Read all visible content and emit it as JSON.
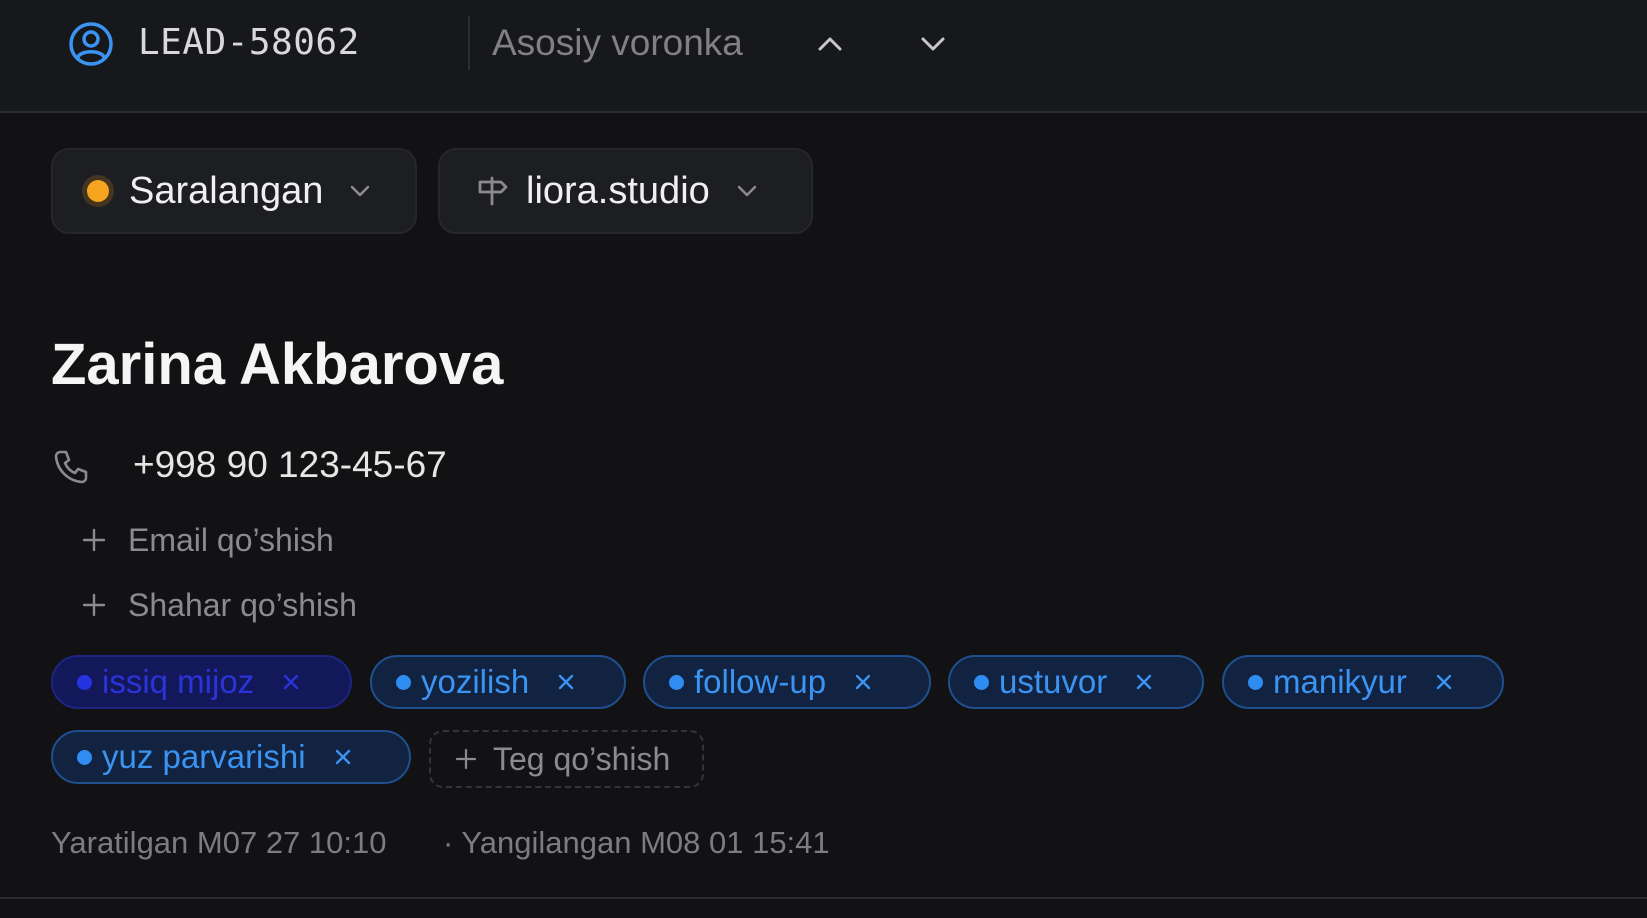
{
  "header": {
    "lead_id": "LEAD-58062",
    "pipeline": "Asosiy voronka",
    "icons": {
      "lead": "user-circle-icon",
      "prev": "chevron-up-icon",
      "next": "chevron-down-icon"
    }
  },
  "status": {
    "label": "Saralangan",
    "color": "#f6a31d"
  },
  "source": {
    "label": "liora.studio",
    "icon": "signpost-icon"
  },
  "contact": {
    "name": "Zarina Akbarova",
    "phone": "+998 90 123-45-67",
    "add_email": "Email qo’shish",
    "add_city": "Shahar qo’shish"
  },
  "tags": [
    {
      "label": "issiq mijoz"
    },
    {
      "label": "yozilish"
    },
    {
      "label": "follow-up"
    },
    {
      "label": "ustuvor"
    },
    {
      "label": "manikyur"
    },
    {
      "label": "yuz parvarishi"
    }
  ],
  "add_tag": "Teg qo’shish",
  "meta": {
    "created": "Yaratilgan M07 27 10:10",
    "updated": "· Yangilangan M08 01 15:41"
  },
  "colors": {
    "background": "#121214",
    "tag_blue": "#3b93f2",
    "tag_hot": "#2a34d8"
  }
}
